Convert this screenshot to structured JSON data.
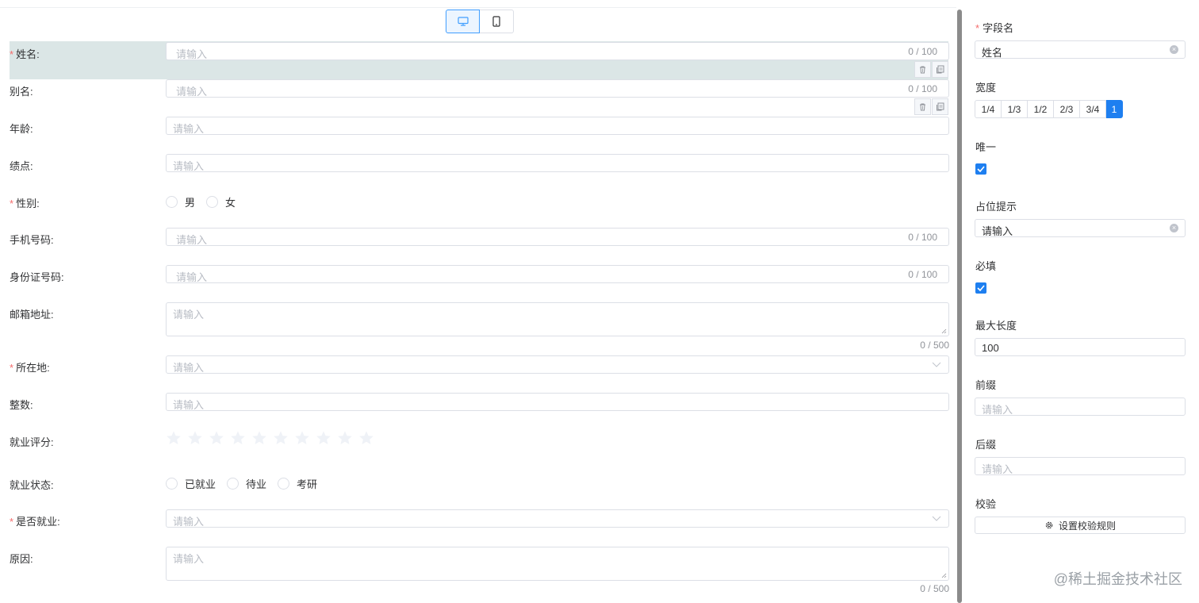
{
  "canvas": {
    "device_switch": {
      "desktop_icon": "monitor-icon",
      "mobile_icon": "phone-icon",
      "active": "desktop"
    },
    "fields": {
      "name": {
        "label": "姓名:",
        "required": true,
        "placeholder": "请输入",
        "count": "0 / 100"
      },
      "alias": {
        "label": "别名:",
        "placeholder": "请输入",
        "count": "0 / 100"
      },
      "age": {
        "label": "年龄:",
        "placeholder": "请输入"
      },
      "gpa": {
        "label": "绩点:",
        "placeholder": "请输入"
      },
      "gender": {
        "label": "性别:",
        "required": true,
        "options": [
          "男",
          "女"
        ]
      },
      "phone": {
        "label": "手机号码:",
        "placeholder": "请输入",
        "count": "0 / 100"
      },
      "id_card": {
        "label": "身份证号码:",
        "placeholder": "请输入",
        "count": "0 / 100"
      },
      "email": {
        "label": "邮箱地址:",
        "placeholder": "请输入",
        "count": "0 / 500"
      },
      "location": {
        "label": "所在地:",
        "required": true,
        "placeholder": "请输入"
      },
      "integer": {
        "label": "整数:",
        "placeholder": "请输入"
      },
      "rating": {
        "label": "就业评分:",
        "max": 10,
        "value": 0
      },
      "employment_status": {
        "label": "就业状态:",
        "options": [
          "已就业",
          "待业",
          "考研"
        ]
      },
      "employed": {
        "label": "是否就业:",
        "required": true,
        "placeholder": "请输入"
      },
      "reason": {
        "label": "原因:",
        "placeholder": "请输入",
        "count": "0 / 500"
      }
    },
    "tool_icons": {
      "delete": "trash-icon",
      "copy": "copy-icon"
    }
  },
  "panel": {
    "field_name": {
      "label": "字段名",
      "required": true,
      "value": "姓名"
    },
    "width": {
      "label": "宽度",
      "options": [
        "1/4",
        "1/3",
        "1/2",
        "2/3",
        "3/4",
        "1"
      ],
      "selected": "1"
    },
    "unique": {
      "label": "唯一",
      "checked": true
    },
    "placeholder": {
      "label": "占位提示",
      "value": "请输入"
    },
    "required": {
      "label": "必填",
      "checked": true
    },
    "max_length": {
      "label": "最大长度",
      "value": "100"
    },
    "prefix": {
      "label": "前缀",
      "placeholder": "请输入"
    },
    "suffix": {
      "label": "后缀",
      "placeholder": "请输入"
    },
    "validation": {
      "label": "校验",
      "button": "设置校验规则",
      "icon": "gear-icon"
    }
  },
  "watermark": "@稀土掘金技术社区",
  "colors": {
    "primary": "#1e7ff0",
    "required_star": "#f56c6c",
    "selected_bg": "#dbe6e6",
    "border": "#dcdfe6",
    "placeholder": "#b8bcc4"
  }
}
